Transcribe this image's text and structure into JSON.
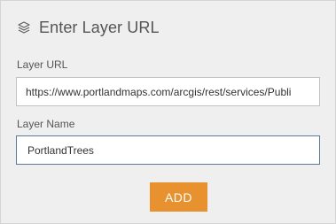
{
  "dialog": {
    "title": "Enter Layer URL",
    "title_icon": "layers-icon"
  },
  "layer_url": {
    "label": "Layer URL",
    "value": "https://www.portlandmaps.com/arcgis/rest/services/Publi"
  },
  "layer_name": {
    "label": "Layer Name",
    "value": "PortlandTrees"
  },
  "actions": {
    "add_label": "ADD"
  },
  "colors": {
    "panel_bg": "#efefef",
    "accent_button": "#e8912f",
    "focus_border": "#5b7a9a"
  }
}
